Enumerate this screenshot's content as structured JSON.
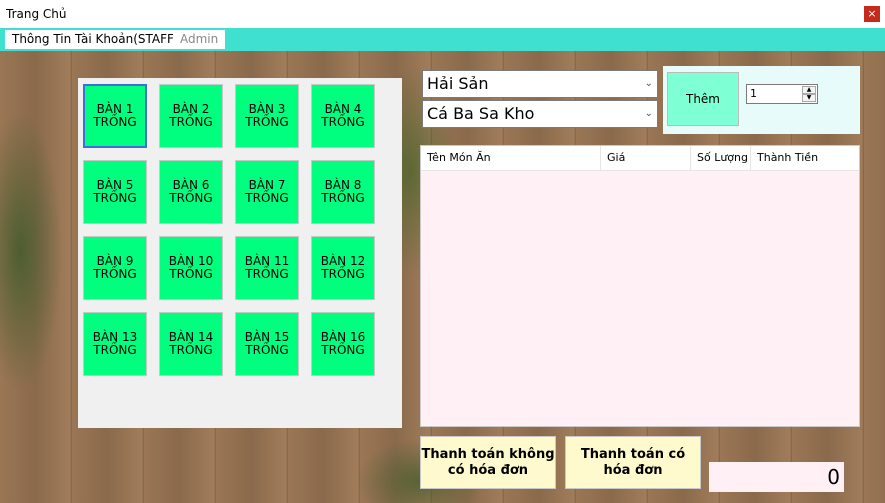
{
  "window": {
    "title": "Trang Chủ",
    "close": "×"
  },
  "menu": {
    "staff": "Thông Tin Tài Khoản(STAFF)",
    "admin": "Admin"
  },
  "tables": [
    {
      "name": "BÀN 1",
      "status": "TRỐNG"
    },
    {
      "name": "BÀN 2",
      "status": "TRỐNG"
    },
    {
      "name": "BÀN 3",
      "status": "TRỐNG"
    },
    {
      "name": "BÀN 4",
      "status": "TRỐNG"
    },
    {
      "name": "BÀN 5",
      "status": "TRỐNG"
    },
    {
      "name": "BÀN 6",
      "status": "TRỐNG"
    },
    {
      "name": "BÀN 7",
      "status": "TRỐNG"
    },
    {
      "name": "BÀN 8",
      "status": "TRỐNG"
    },
    {
      "name": "BÀN 9",
      "status": "TRỐNG"
    },
    {
      "name": "BÀN 10",
      "status": "TRỐNG"
    },
    {
      "name": "BÀN 11",
      "status": "TRỐNG"
    },
    {
      "name": "BÀN 12",
      "status": "TRỐNG"
    },
    {
      "name": "BÀN 13",
      "status": "TRỐNG"
    },
    {
      "name": "BÀN 14",
      "status": "TRỐNG"
    },
    {
      "name": "BÀN 15",
      "status": "TRỐNG"
    },
    {
      "name": "BÀN 16",
      "status": "TRỐNG"
    }
  ],
  "category": {
    "selected": "Hải Sản"
  },
  "food": {
    "selected": "Cá Ba Sa Kho"
  },
  "add_button": "Thêm",
  "quantity": "1",
  "order_columns": [
    "Tên Món Ăn",
    "Giá",
    "Số Lượng",
    "Thành Tiền"
  ],
  "pay": {
    "no_invoice": "Thanh toán không có hóa đơn",
    "with_invoice": "Thanh toán có hóa đơn"
  },
  "total": "0",
  "colors": {
    "table_empty": "#00ff7f",
    "menubar": "#40e0d0",
    "add_button": "#7fffd4",
    "pay_button": "#fffacd",
    "list_bg": "#fff0f5"
  }
}
